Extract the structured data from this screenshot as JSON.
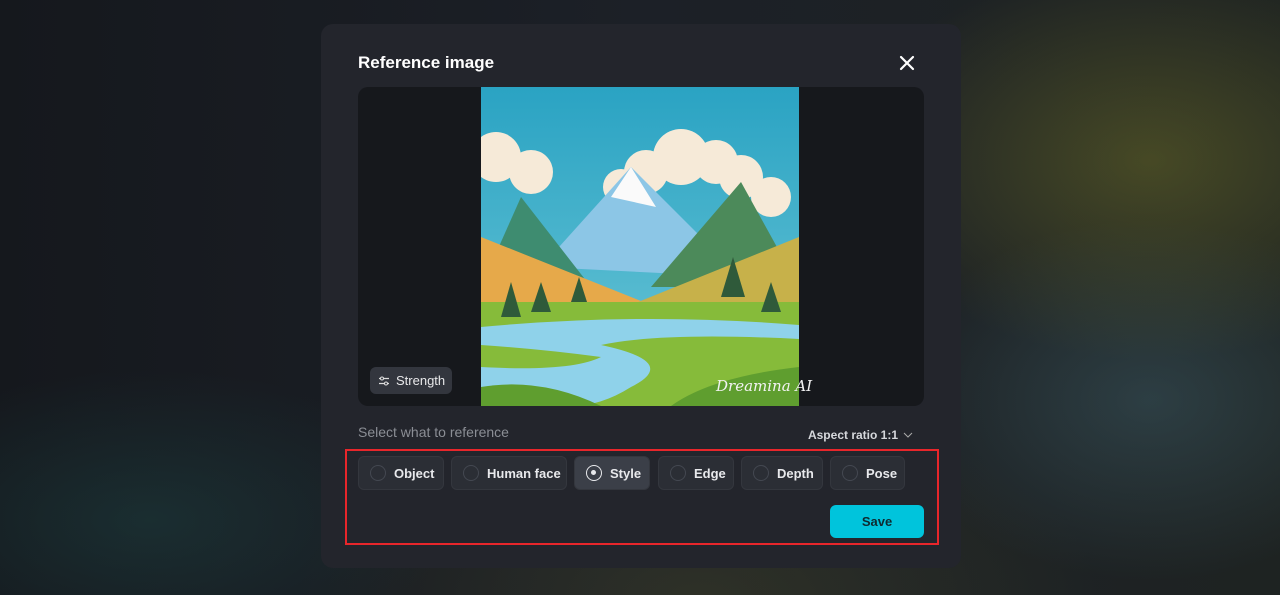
{
  "modal": {
    "title": "Reference image",
    "strength_label": "Strength",
    "watermark": "Dreamina AI",
    "select_label": "Select what to reference",
    "aspect_ratio": "Aspect ratio 1:1",
    "options": [
      {
        "label": "Object",
        "selected": false
      },
      {
        "label": "Human face",
        "selected": false
      },
      {
        "label": "Style",
        "selected": true
      },
      {
        "label": "Edge",
        "selected": false
      },
      {
        "label": "Depth",
        "selected": false
      },
      {
        "label": "Pose",
        "selected": false
      }
    ],
    "save_label": "Save"
  },
  "colors": {
    "accent": "#00c4dc",
    "highlight": "#e8262b"
  }
}
